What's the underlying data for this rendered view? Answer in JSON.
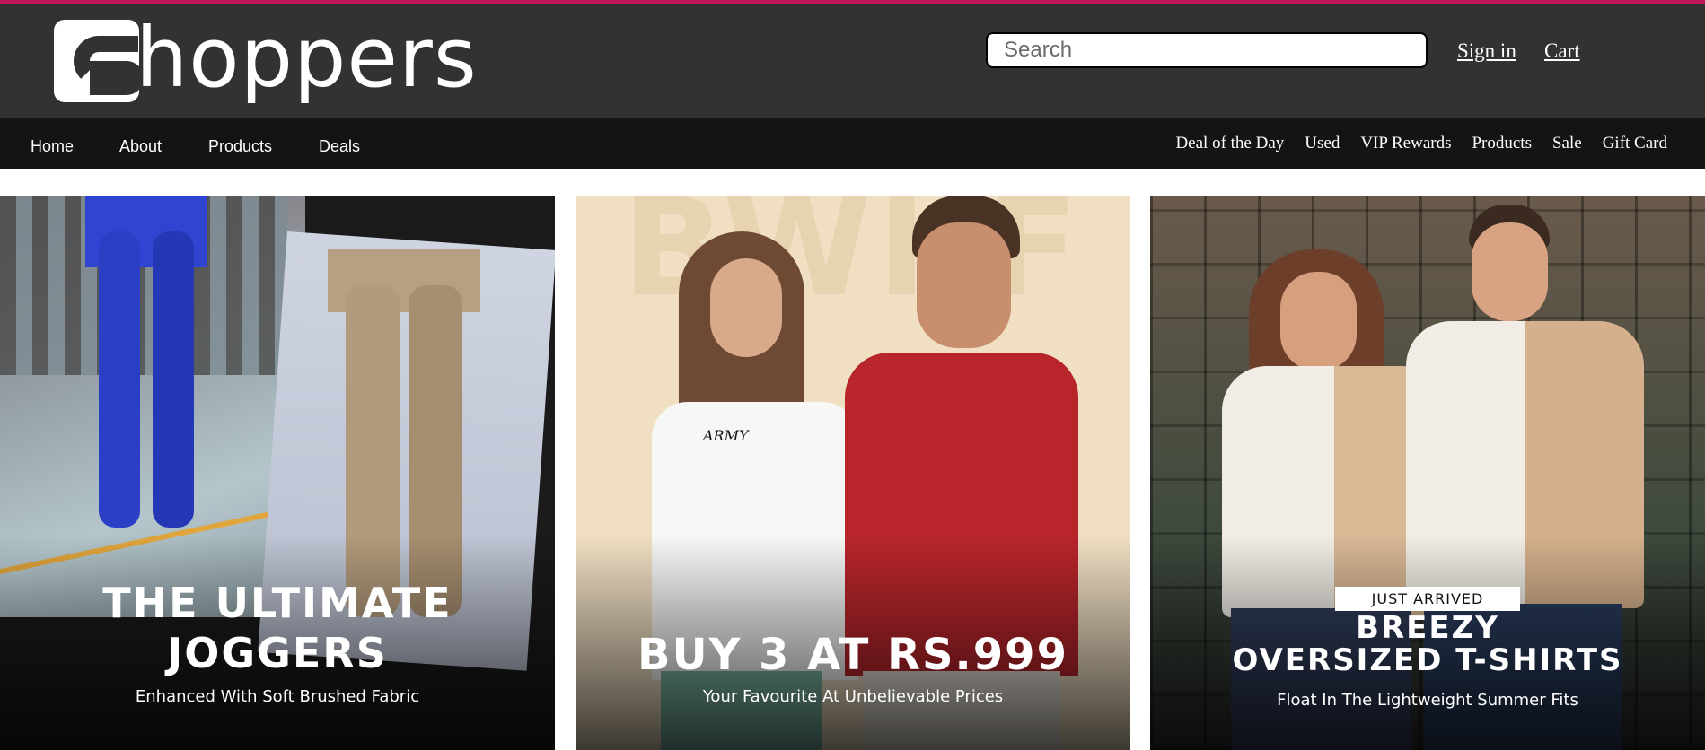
{
  "header": {
    "logo_text": "hoppers",
    "logo_initial": "S",
    "search_placeholder": "Search",
    "signin_label": "Sign in",
    "cart_label": "Cart"
  },
  "nav": {
    "left": [
      "Home",
      "About",
      "Products",
      "Deals"
    ],
    "right": [
      "Deal of the Day",
      "Used",
      "VIP Rewards",
      "Products",
      "Sale",
      "Gift Card"
    ]
  },
  "banners": [
    {
      "title_line1": "THE ULTIMATE",
      "title_line2": "JOGGERS",
      "subtitle": "Enhanced With Soft Brushed Fabric"
    },
    {
      "background_text": "BWKF",
      "shirt_print": "ARMY",
      "title": "BUY 3 AT RS.999",
      "subtitle": "Your Favourite At Unbelievable Prices"
    },
    {
      "tag": "JUST ARRIVED",
      "title_line1": "BREEZY",
      "title_line2": "OVERSIZED T-SHIRTS",
      "subtitle": "Float In The Lightweight Summer Fits"
    }
  ],
  "colors": {
    "accent_line": "#c2185b",
    "header_bg": "#333132",
    "nav_bg": "#141414"
  }
}
